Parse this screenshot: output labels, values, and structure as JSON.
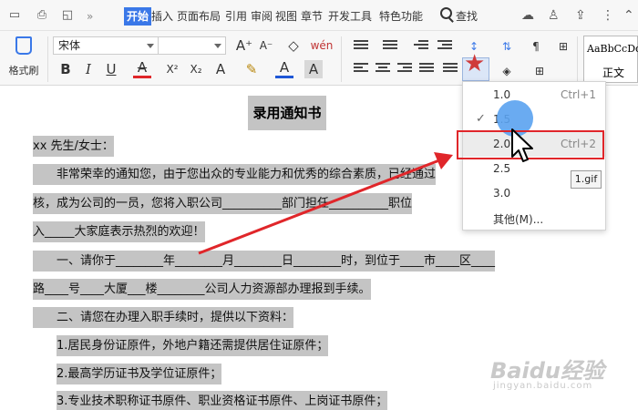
{
  "menubar": {
    "tabs": [
      "开始",
      "插入",
      "页面布局",
      "引用",
      "审阅",
      "视图",
      "章节",
      "开发工具",
      "特色功能"
    ],
    "active_tab": "开始",
    "search_label": "查找",
    "more_glyph": "»"
  },
  "ribbon": {
    "format_painter": "格式刷",
    "font_name": "宋体",
    "font_size": "",
    "style_sample": "AaBbCcDd",
    "style_name": "正文",
    "buttons": {
      "bold": "B",
      "italic": "I",
      "underline": "U",
      "strike": "A",
      "superscript": "X²",
      "subscript": "X₂",
      "text_effect": "A",
      "font_color": "A",
      "char_shade": "A",
      "grow": "A⁺",
      "shrink": "A⁻",
      "phonetic": "wén",
      "clear": "◇"
    },
    "accent_color": "#3a78e8",
    "highlight_color": "#e0262a"
  },
  "line_spacing_menu": {
    "items": [
      {
        "value": "1.0",
        "shortcut": "Ctrl+1",
        "checked": false
      },
      {
        "value": "1.5",
        "shortcut": "",
        "checked": true
      },
      {
        "value": "2.0",
        "shortcut": "Ctrl+2",
        "checked": false,
        "hover": true
      },
      {
        "value": "2.5",
        "shortcut": "",
        "checked": false
      },
      {
        "value": "3.0",
        "shortcut": "",
        "checked": false
      },
      {
        "value": "其他(M)...",
        "shortcut": "",
        "checked": false
      }
    ],
    "tooltip": "1.gif"
  },
  "document": {
    "title": "录用通知书",
    "lines": [
      "xx 先生/女士：",
      "非常荣幸的通知您，由于您出众的专业能力和优秀的综合素质，已经通过",
      "核，成为公司的一员，您将入职公司__________部门担任__________职位",
      "入_____大家庭表示热烈的欢迎！",
      "一、请你于________年________月________日________时，到位于____市____区____",
      "路____号____大厦___楼________公司人力资源部办理报到手续。",
      "二、请您在办理入职手续时，提供以下资料：",
      "1.居民身份证原件，外地户籍还需提供居住证原件；",
      "2.最高学历证书及学位证原件；",
      "3.专业技术职称证书原件、职业资格证书原件、上岗证书原件；"
    ]
  },
  "watermark": {
    "text": "Baidu经验",
    "sub": "jingyan.baidu.com"
  }
}
